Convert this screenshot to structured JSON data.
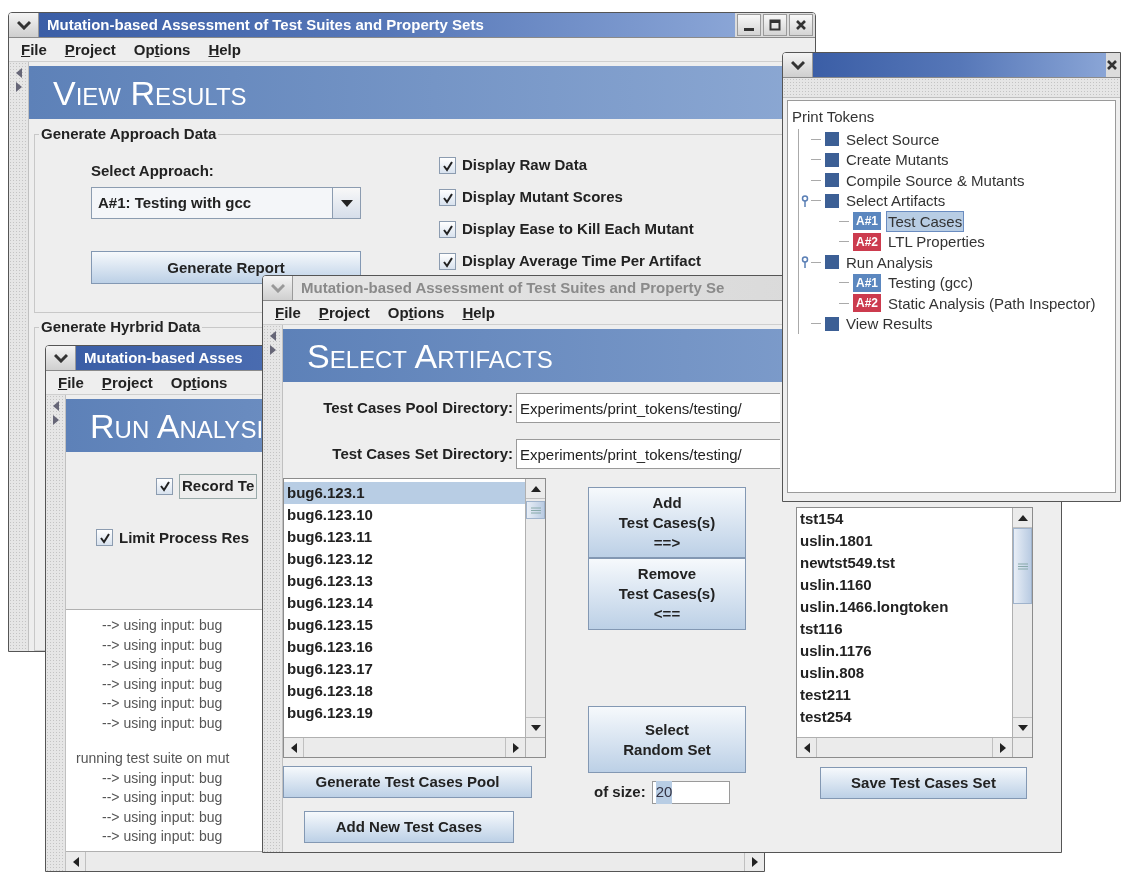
{
  "results_window": {
    "title": "Mutation-based Assessment of Test Suites and Property Sets",
    "active": true,
    "menu": [
      {
        "key": "F",
        "after": "ile"
      },
      {
        "key": "P",
        "after": "roject"
      },
      {
        "before": "Op",
        "key": "t",
        "after": "ions"
      },
      {
        "key": "H",
        "after": "elp"
      }
    ],
    "heading": "View Results",
    "approach_group": {
      "title": "Generate Approach Data",
      "select_label": "Select Approach:",
      "approach": "A#1: Testing with gcc",
      "button": "Generate Report",
      "options": [
        {
          "label": "Display Raw Data",
          "checked": true
        },
        {
          "label": "Display Mutant Scores",
          "checked": true
        },
        {
          "label": "Display Ease to Kill Each Mutant",
          "checked": true
        },
        {
          "label": "Display Average Time Per Artifact",
          "checked": true
        }
      ]
    },
    "hybrid_group": {
      "title": "Generate Hyrbrid Data"
    }
  },
  "analysis_window": {
    "title": "Mutation-based Asses",
    "active": true,
    "menu": [
      {
        "key": "F",
        "after": "ile"
      },
      {
        "key": "P",
        "after": "roject"
      },
      {
        "before": "Op",
        "key": "t",
        "after": "ions"
      }
    ],
    "heading": "Run Analysi",
    "options": [
      {
        "label": "Record Te",
        "checked": true
      },
      {
        "label": "Limit Process Res",
        "checked": true
      }
    ],
    "log": [
      {
        "kind": "input",
        "text": "--> using input: bug"
      },
      {
        "kind": "input",
        "text": "--> using input: bug"
      },
      {
        "kind": "input",
        "text": "--> using input: bug"
      },
      {
        "kind": "input",
        "text": "--> using input: bug"
      },
      {
        "kind": "input",
        "text": "--> using input: bug"
      },
      {
        "kind": "input",
        "text": "--> using input: bug"
      },
      {
        "kind": "run",
        "text": "running test suite on mut"
      },
      {
        "kind": "input",
        "text": "--> using input: bug"
      },
      {
        "kind": "input",
        "text": "--> using input: bug"
      },
      {
        "kind": "input",
        "text": "--> using input: bug"
      },
      {
        "kind": "input",
        "text": "--> using input: bug"
      }
    ]
  },
  "artifacts_window": {
    "title": "Mutation-based Assessment of Test Suites and Property Se",
    "active": false,
    "menu": [
      {
        "key": "F",
        "after": "ile"
      },
      {
        "key": "P",
        "after": "roject"
      },
      {
        "before": "Op",
        "key": "t",
        "after": "ions"
      },
      {
        "key": "H",
        "after": "elp"
      }
    ],
    "heading": "Select Artifacts",
    "fields": [
      {
        "label": "Test Cases Pool Directory:",
        "value": "Experiments/print_tokens/testing/"
      },
      {
        "label": "Test Cases Set Directory:",
        "value": "Experiments/print_tokens/testing/"
      }
    ],
    "pool": [
      {
        "text": "bug6.123.1",
        "selected": true
      },
      {
        "text": "bug6.123.10",
        "selected": false
      },
      {
        "text": "bug6.123.11",
        "selected": false
      },
      {
        "text": "bug6.123.12",
        "selected": false
      },
      {
        "text": "bug6.123.13",
        "selected": false
      },
      {
        "text": "bug6.123.14",
        "selected": false
      },
      {
        "text": "bug6.123.15",
        "selected": false
      },
      {
        "text": "bug6.123.16",
        "selected": false
      },
      {
        "text": "bug6.123.17",
        "selected": false
      },
      {
        "text": "bug6.123.18",
        "selected": false
      },
      {
        "text": "bug6.123.19",
        "selected": false
      }
    ],
    "generate_button": "Generate Test Cases Pool",
    "add_new_button": "Add New Test Cases",
    "add_button": [
      "Add",
      "Test Cases(s)",
      "==>"
    ],
    "remove_button": [
      "Remove",
      "Test Cases(s)",
      "<=="
    ],
    "random_button": [
      "Select",
      "Random Set"
    ],
    "size_label": "of size:",
    "size": "20",
    "set": [
      {
        "text": "tst154",
        "selected": false
      },
      {
        "text": "uslin.1801",
        "selected": false
      },
      {
        "text": "newtst549.tst",
        "selected": false
      },
      {
        "text": "uslin.1160",
        "selected": false
      },
      {
        "text": "uslin.1466.longtoken",
        "selected": false
      },
      {
        "text": "tst116",
        "selected": false
      },
      {
        "text": "uslin.1176",
        "selected": false
      },
      {
        "text": "uslin.808",
        "selected": false
      },
      {
        "text": "test211",
        "selected": false
      },
      {
        "text": "test254",
        "selected": false
      }
    ],
    "save_button": "Save Test Cases Set"
  },
  "tree_window": {
    "active": true,
    "root": "Print Tokens",
    "items": [
      {
        "kind": "step",
        "label": "Select Source",
        "selected": false
      },
      {
        "kind": "step",
        "label": "Create Mutants",
        "selected": false
      },
      {
        "kind": "step",
        "label": "Compile Source & Mutants",
        "selected": false
      },
      {
        "kind": "step",
        "label": "Select Artifacts",
        "selected": false,
        "expanded": true,
        "children": [
          {
            "kind": "approach",
            "badge": "A#1",
            "color": "#5b87bf",
            "label": "Test Cases",
            "selected": true
          },
          {
            "kind": "approach",
            "badge": "A#2",
            "color": "#cc3b4e",
            "label": "LTL Properties",
            "selected": false
          }
        ]
      },
      {
        "kind": "step",
        "label": "Run Analysis",
        "selected": false,
        "expanded": true,
        "children": [
          {
            "kind": "approach",
            "badge": "A#1",
            "color": "#5b87bf",
            "label": "Testing (gcc)",
            "selected": false
          },
          {
            "kind": "approach",
            "badge": "A#2",
            "color": "#cc3b4e",
            "label": "Static Analysis (Path Inspector)",
            "selected": false
          }
        ]
      },
      {
        "kind": "step",
        "label": "View Results",
        "selected": false
      }
    ]
  }
}
